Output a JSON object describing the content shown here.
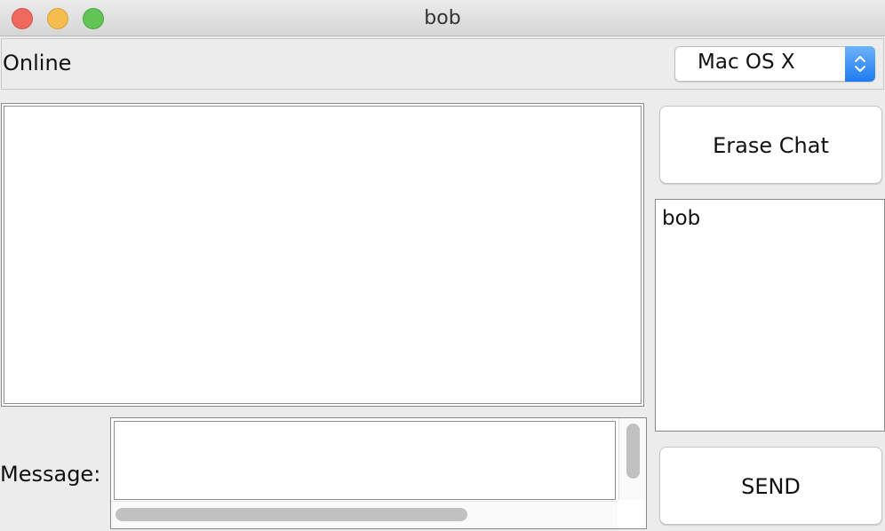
{
  "window": {
    "title": "bob"
  },
  "header": {
    "status": "Online",
    "look_and_feel": "Mac OS X"
  },
  "buttons": {
    "erase": "Erase Chat",
    "send": "SEND"
  },
  "users": [
    "bob"
  ],
  "message": {
    "label": "Message:",
    "value": ""
  },
  "icons": {
    "close": "close-icon",
    "minimize": "minimize-icon",
    "maximize": "maximize-icon",
    "select_arrows": "chevron-updown-icon"
  },
  "colors": {
    "close": "#ee6a5e",
    "minimize": "#f5bd4f",
    "maximize": "#61c454",
    "select_accent": "#1e7bf1"
  }
}
